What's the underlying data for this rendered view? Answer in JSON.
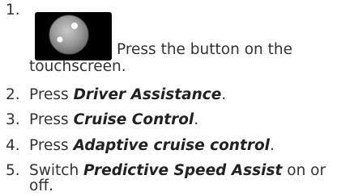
{
  "steps": [
    {
      "number": "1.",
      "before": "",
      "term": "",
      "after": "Press the button on the",
      "after_line2": "touchscreen.",
      "icon": "round-touchscreen-button-icon"
    },
    {
      "number": "2.",
      "before": "Press ",
      "term": "Driver Assistance",
      "after": "."
    },
    {
      "number": "3.",
      "before": "Press ",
      "term": "Cruise Control",
      "after": "."
    },
    {
      "number": "4.",
      "before": "Press ",
      "term": "Adaptive cruise control",
      "after": "."
    },
    {
      "number": "5.",
      "before": "Switch ",
      "term": "Predictive Speed Assist",
      "after": " on or",
      "after_line2": "off."
    }
  ],
  "colors": {
    "text": "#333333",
    "icon_background": "#000000",
    "icon_button": "#9a9a9a"
  }
}
